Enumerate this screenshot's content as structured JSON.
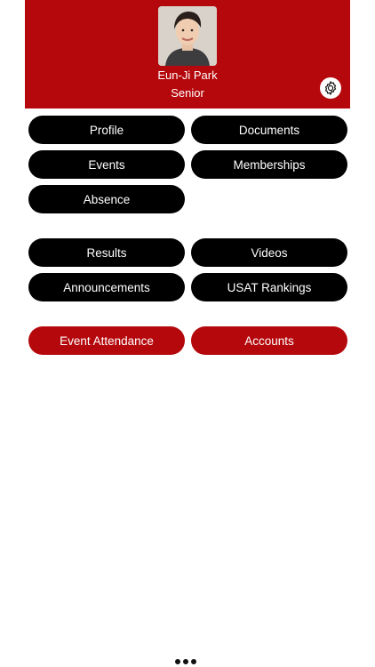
{
  "header": {
    "user_name": "Eun-Ji Park",
    "user_role": "Senior",
    "avatar": "profile-photo",
    "settings_icon": "gear-icon",
    "background_color": "#b5080c"
  },
  "menu": {
    "group1": {
      "profile": "Profile",
      "documents": "Documents",
      "events": "Events",
      "memberships": "Memberships",
      "absence": "Absence"
    },
    "group2": {
      "results": "Results",
      "videos": "Videos",
      "announcements": "Announcements",
      "usat_rankings": "USAT Rankings"
    },
    "group3": {
      "event_attendance": "Event Attendance",
      "accounts": "Accounts"
    }
  },
  "colors": {
    "primary_button": "#000000",
    "accent_button": "#b5080c",
    "button_text": "#ffffff"
  },
  "footer": {
    "more_icon": "more-dots-icon"
  }
}
